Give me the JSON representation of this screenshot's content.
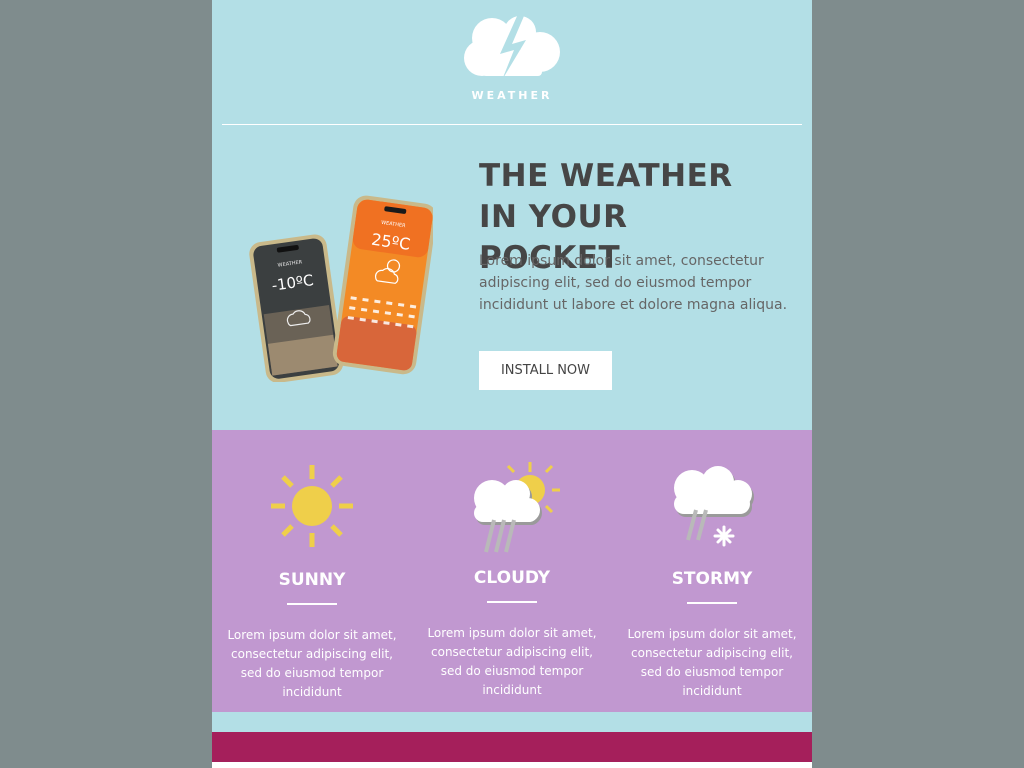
{
  "header": {
    "logo_icon": "lightning-cloud-icon",
    "logo_text": "WEATHER"
  },
  "hero": {
    "title": "THE WEATHER IN YOUR POCKET",
    "body": "Lorem ipsum dolor sit amet, consectetur adipiscing elit, sed do eiusmod tempor incididunt ut labore et dolore magna aliqua.",
    "cta_label": "INSTALL NOW",
    "phone_left": {
      "brand": "WEATHER",
      "temp": "-10ºC"
    },
    "phone_right": {
      "brand": "WEATHER",
      "temp": "25ºC"
    }
  },
  "features": [
    {
      "icon": "sun-icon",
      "title": "SUNNY",
      "body": "Lorem ipsum dolor sit amet, consectetur adipiscing elit, sed do eiusmod tempor incididunt"
    },
    {
      "icon": "cloud-sun-rain-icon",
      "title": "CLOUDY",
      "body": "Lorem ipsum dolor sit amet, consectetur adipiscing elit, sed do eiusmod tempor incididunt"
    },
    {
      "icon": "cloud-rain-snow-icon",
      "title": "STORMY",
      "body": "Lorem ipsum dolor sit amet, consectetur adipiscing elit, sed do eiusmod tempor incididunt"
    }
  ],
  "colors": {
    "background": "#7f8c8d",
    "email_bg": "#b3dfe6",
    "features_bg": "#c198d0",
    "footer_bar": "#a51f5b",
    "sun": "#efcf4a",
    "title_text": "#464646"
  }
}
